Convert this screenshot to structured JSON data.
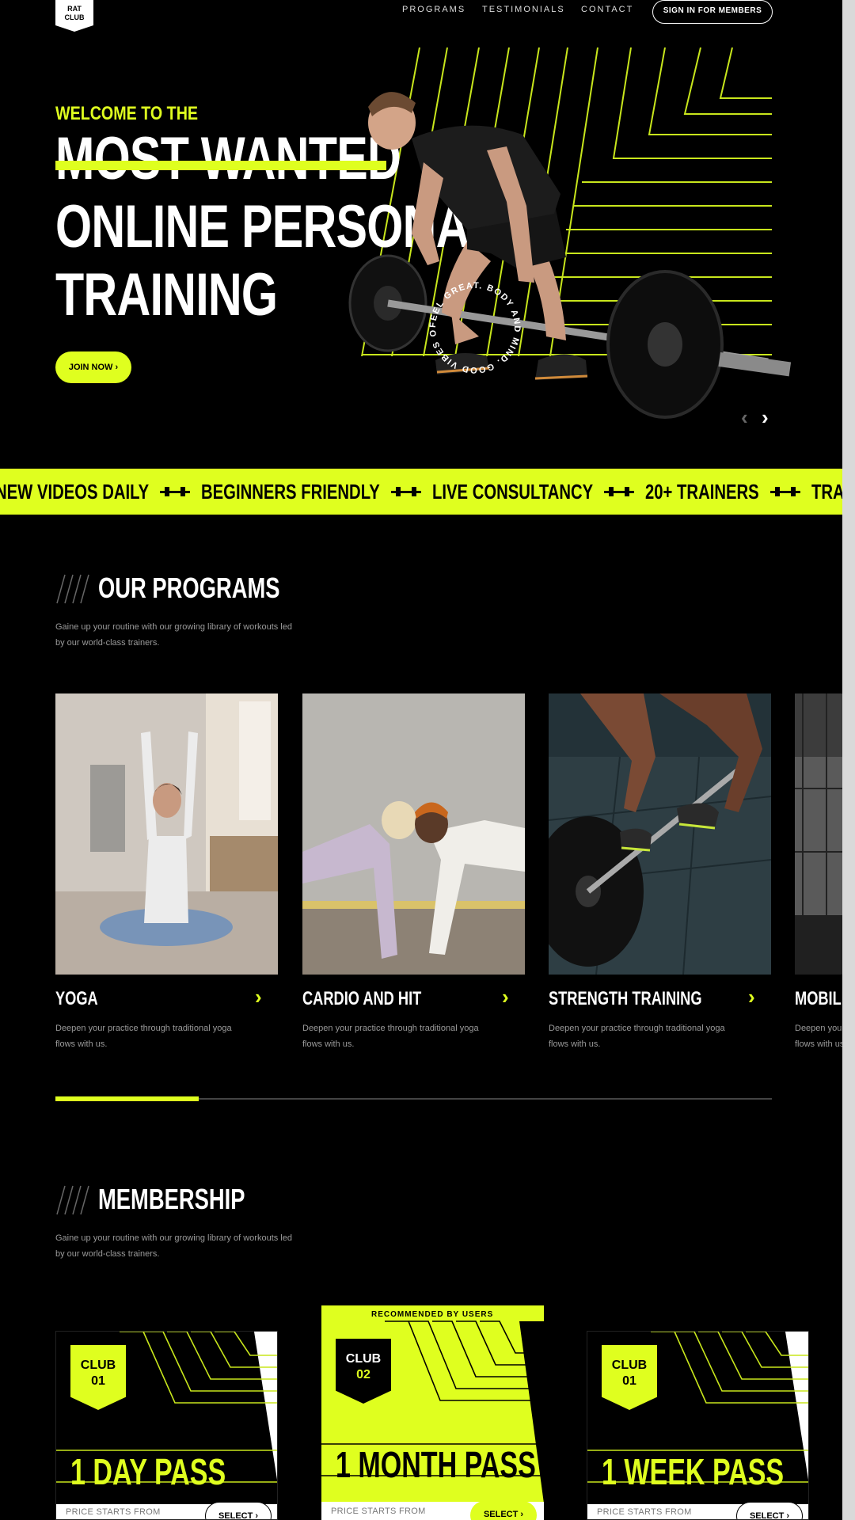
{
  "nav": {
    "logo_line1": "RAT",
    "logo_line2": "CLUB",
    "links": [
      "PROGRAMS",
      "TESTIMONIALS",
      "CONTACT"
    ],
    "signin_label": "SIGN IN FOR MEMBERS"
  },
  "hero": {
    "welcome": "WELCOME TO THE",
    "line1": "MOST WANTED",
    "line2": "ONLINE PERSONAL",
    "line3": "TRAINING",
    "join_label": "JOIN NOW ›",
    "badge_text": "FEEL GREAT. BODY AND MIND. GOOD VIBES ONLY.",
    "prev_arrow": "‹",
    "next_arrow": "›"
  },
  "ticker": {
    "items": [
      "NEW VIDEOS DAILY",
      "BEGINNERS FRIENDLY",
      "LIVE CONSULTANCY",
      "20+ TRAINERS",
      "TRAIN ANYWHERE"
    ]
  },
  "programs": {
    "title": "OUR PROGRAMS",
    "description": "Gaine up your routine with our growing library of workouts led by our world-class trainers.",
    "cards": [
      {
        "title": "YOGA",
        "description": "Deepen your practice through traditional yoga flows with us.",
        "arrow": "›"
      },
      {
        "title": "CARDIO AND HIT",
        "description": "Deepen your practice through traditional yoga flows with us.",
        "arrow": "›"
      },
      {
        "title": "STRENGTH TRAINING",
        "description": "Deepen your practice through traditional yoga flows with us.",
        "arrow": "›"
      },
      {
        "title": "MOBILITY",
        "description": "Deepen your practice through traditional yoga flows with us.",
        "arrow": "›"
      }
    ],
    "progress": 0.2
  },
  "membership": {
    "title": "MEMBERSHIP",
    "description": "Gaine up your routine with our growing library of workouts led by our world-class trainers.",
    "recommended_label": "RECOMMENDED BY USERS",
    "plans": [
      {
        "club": "CLUB",
        "number": "01",
        "title": "1 DAY PASS",
        "price_label": "PRICE STARTS FROM",
        "select_label": "SELECT ›"
      },
      {
        "club": "CLUB",
        "number": "02",
        "title": "1 MONTH PASS",
        "price_label": "PRICE STARTS FROM",
        "select_label": "SELECT ›"
      },
      {
        "club": "CLUB",
        "number": "01",
        "title": "1 WEEK PASS",
        "price_label": "PRICE STARTS FROM",
        "select_label": "SELECT ›"
      }
    ]
  },
  "colors": {
    "accent": "#dfff1f",
    "background": "#000000",
    "text": "#ffffff"
  }
}
